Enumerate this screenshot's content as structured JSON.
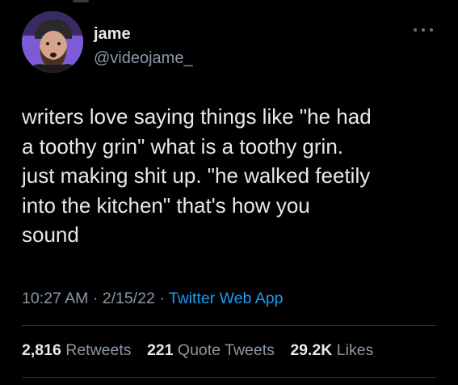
{
  "user": {
    "display_name": "jame",
    "handle": "@videojame_"
  },
  "tweet": {
    "text": "writers love saying things like \"he had\na toothy grin\" what is a toothy grin.\njust making shit up. \"he walked feetily\ninto the kitchen\" that's how you\nsound",
    "time": "10:27 AM",
    "date": "2/15/22",
    "separator": "·",
    "source": "Twitter Web App"
  },
  "stats": {
    "retweets": {
      "count": "2,816",
      "label": "Retweets"
    },
    "quote_tweets": {
      "count": "221",
      "label": "Quote Tweets"
    },
    "likes": {
      "count": "29.2K",
      "label": "Likes"
    }
  },
  "colors": {
    "background": "#000000",
    "text": "#e7e9ea",
    "secondary": "#8b98a5",
    "link": "#1d9bf0",
    "avatar_bg": "#7e5bd6",
    "divider": "#2f3336"
  },
  "icons": {
    "more": "more-horizontal-icon"
  }
}
